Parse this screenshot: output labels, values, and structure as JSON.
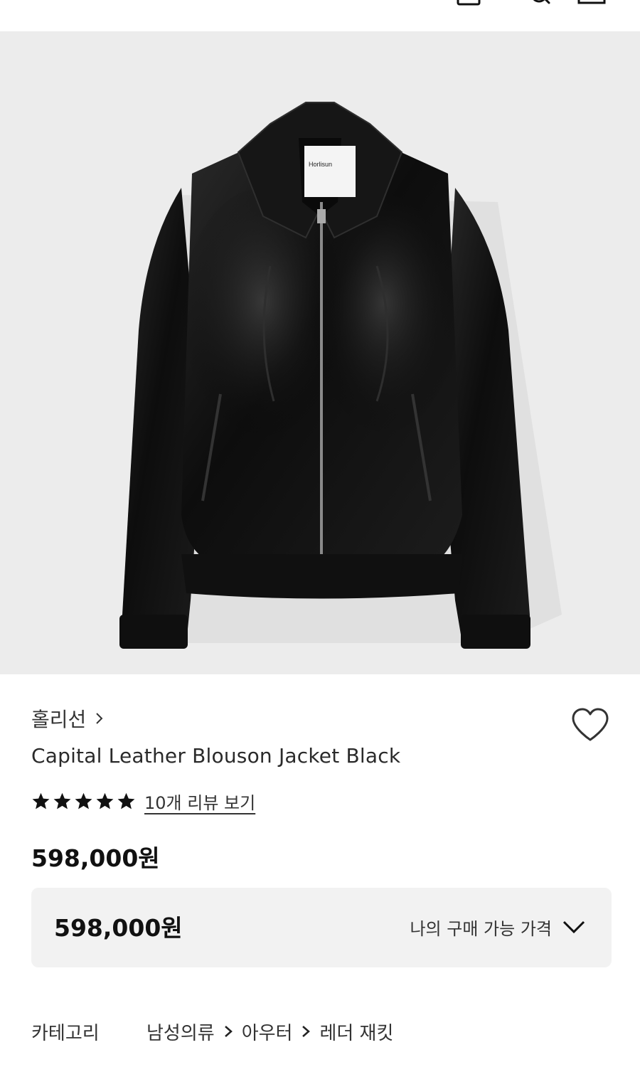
{
  "header": {
    "back_icon": "arrow-left-icon",
    "icons": [
      "cart-icon",
      "search-icon",
      "menu-icon"
    ]
  },
  "hero": {
    "image_subject": "black leather blouson jacket on grey background",
    "label_text": "Horlisun"
  },
  "product": {
    "brand": "홀리선",
    "name": "Capital Leather Blouson Jacket Black",
    "rating_stars": 5,
    "reviews_link": "10개 리뷰 보기",
    "price": "598,000원"
  },
  "price_box": {
    "amount": "598,000원",
    "label": "나의 구매 가능 가격"
  },
  "category": {
    "title": "카테고리",
    "crumbs": [
      "남성의류",
      "아우터",
      "레더 재킷"
    ]
  },
  "colors": {
    "hero_bg": "#ececec",
    "price_box_bg": "#f2f2f2",
    "text_primary": "#111111"
  }
}
